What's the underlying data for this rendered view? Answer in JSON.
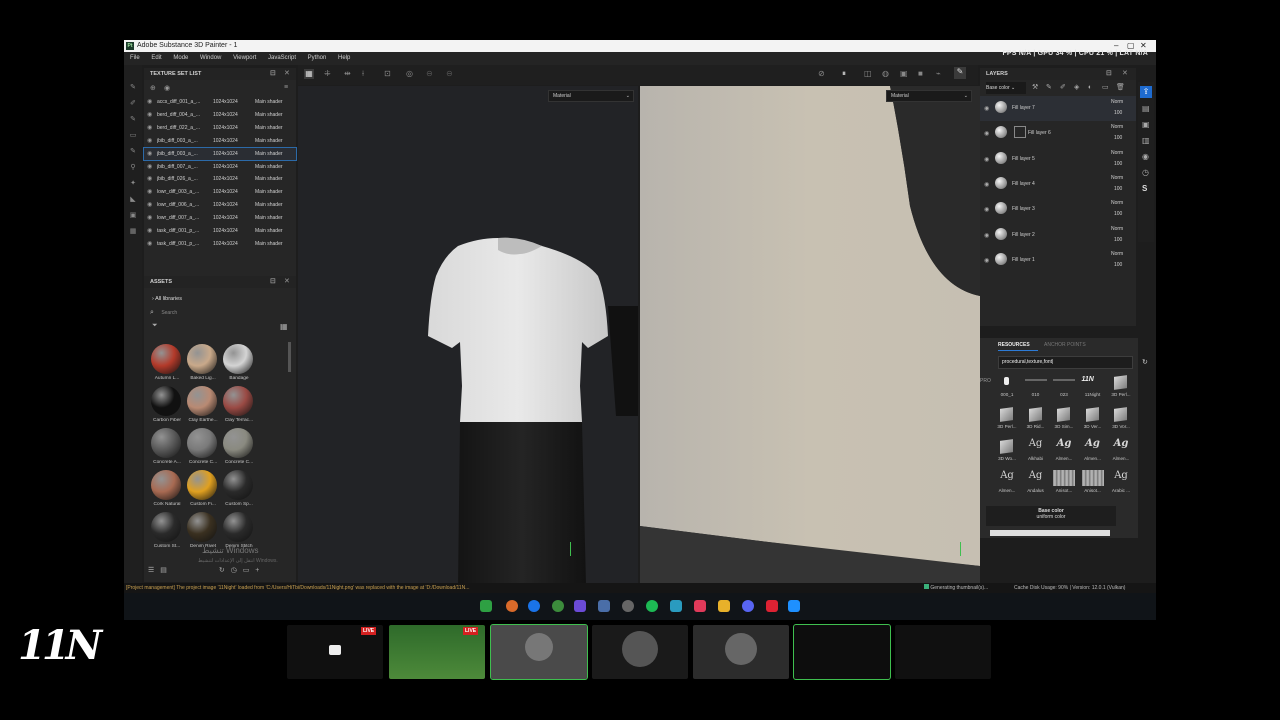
{
  "window": {
    "title": "Adobe Substance 3D Painter - 1",
    "logo_text": "Pt",
    "perf": "FPS N/A | GPU 34 % | CPU 21 % | LAT N/A",
    "controls": [
      "–",
      "▢",
      "✕"
    ]
  },
  "menu": [
    "File",
    "Edit",
    "Mode",
    "Window",
    "Viewport",
    "JavaScript",
    "Python",
    "Help"
  ],
  "texture_set_list": {
    "title": "TEXTURE SET LIST",
    "rows": [
      {
        "name": "accs_diff_001_a_...",
        "res": "1024x1024",
        "shader": "Main shader"
      },
      {
        "name": "berd_diff_004_a_...",
        "res": "1024x1024",
        "shader": "Main shader"
      },
      {
        "name": "berd_diff_022_a_...",
        "res": "1024x1024",
        "shader": "Main shader"
      },
      {
        "name": "jbib_diff_003_a_...",
        "res": "1024x1024",
        "shader": "Main shader"
      },
      {
        "name": "jbib_diff_003_a_...",
        "res": "1024x1024",
        "shader": "Main shader"
      },
      {
        "name": "jbib_diff_007_a_...",
        "res": "1024x1024",
        "shader": "Main shader"
      },
      {
        "name": "jbib_diff_026_a_...",
        "res": "1024x1024",
        "shader": "Main shader"
      },
      {
        "name": "lowr_diff_003_a_...",
        "res": "1024x1024",
        "shader": "Main shader"
      },
      {
        "name": "lowr_diff_006_a_...",
        "res": "1024x1024",
        "shader": "Main shader"
      },
      {
        "name": "lowr_diff_007_a_...",
        "res": "1024x1024",
        "shader": "Main shader"
      },
      {
        "name": "task_diff_001_p_...",
        "res": "1024x1024",
        "shader": "Main shader"
      },
      {
        "name": "task_diff_001_p_...",
        "res": "1024x1024",
        "shader": "Main shader"
      }
    ],
    "selected_index": 4
  },
  "assets": {
    "title": "ASSETS",
    "breadcrumb": "All libraries",
    "search_placeholder": "Search",
    "items": [
      {
        "label": "Autumn L...",
        "color": "#b33a2a"
      },
      {
        "label": "Baked Lig...",
        "color": "#c9a98a"
      },
      {
        "label": "Bandage",
        "color": "#d4d4d4"
      },
      {
        "label": "Carbon Fiber",
        "color": "#111111"
      },
      {
        "label": "Clay Earthe...",
        "color": "#b98a73"
      },
      {
        "label": "Clay Terrac...",
        "color": "#9a4a44"
      },
      {
        "label": "Concrete A...",
        "color": "#5a5a5a"
      },
      {
        "label": "Concrete C...",
        "color": "#7a7a7a"
      },
      {
        "label": "Concrete C...",
        "color": "#8a8a80"
      },
      {
        "label": "Cork Natural",
        "color": "#a86a52"
      },
      {
        "label": "Custom Fi...",
        "color": "#e0a020"
      },
      {
        "label": "Custom Sp...",
        "color": "#2a2a2a"
      },
      {
        "label": "Custom St...",
        "color": "#2a2a2a"
      },
      {
        "label": "Denim Rivet",
        "color": "#3a3020"
      },
      {
        "label": "Denim Stitch",
        "color": "#2a2a2a"
      }
    ],
    "watermark_line1": "تنشيط Windows",
    "watermark_line2": "انتقل إلى الإعدادات لتنشيط Windows."
  },
  "viewport": {
    "left_dropdown": "Material",
    "right_dropdown": "Material"
  },
  "layers": {
    "title": "LAYERS",
    "channel": "Base color",
    "rows": [
      {
        "name": "Fill layer 7",
        "blend": "Norm",
        "opacity": "100"
      },
      {
        "name": "Fill layer 6",
        "blend": "Norm",
        "opacity": "100"
      },
      {
        "name": "Fill layer 5",
        "blend": "Norm",
        "opacity": "100"
      },
      {
        "name": "Fill layer 4",
        "blend": "Norm",
        "opacity": "100"
      },
      {
        "name": "Fill layer 3",
        "blend": "Norm",
        "opacity": "100"
      },
      {
        "name": "Fill layer 2",
        "blend": "Norm",
        "opacity": "100"
      },
      {
        "name": "Fill layer 1",
        "blend": "Norm",
        "opacity": "100"
      }
    ]
  },
  "resources": {
    "tab_active": "RESOURCES",
    "tab_inactive": "ANCHOR POINTS",
    "search_value": "procedural,texture,font|",
    "items": [
      {
        "label": "000_1",
        "kind": "dot"
      },
      {
        "label": "010",
        "kind": "text"
      },
      {
        "label": "023",
        "kind": "text"
      },
      {
        "label": "11Night",
        "kind": "script"
      },
      {
        "label": "3D Perl...",
        "kind": "cube"
      },
      {
        "label": "3D Perl...",
        "kind": "cube"
      },
      {
        "label": "3D Rid...",
        "kind": "cube"
      },
      {
        "label": "3D Sim...",
        "kind": "cube"
      },
      {
        "label": "3D Ver...",
        "kind": "cube"
      },
      {
        "label": "3D Vor...",
        "kind": "cube"
      },
      {
        "label": "3D Wo...",
        "kind": "cube"
      },
      {
        "label": "Alkhabi",
        "kind": "ag"
      },
      {
        "label": "Almen...",
        "kind": "agb"
      },
      {
        "label": "Almen...",
        "kind": "agb"
      },
      {
        "label": "Almen...",
        "kind": "agb"
      },
      {
        "label": "Almen...",
        "kind": "ag"
      },
      {
        "label": "Andalus",
        "kind": "ag"
      },
      {
        "label": "Anisot...",
        "kind": "metal"
      },
      {
        "label": "Anisot...",
        "kind": "metal"
      },
      {
        "label": "Arabic ...",
        "kind": "ag"
      }
    ],
    "glyph": "Ag",
    "tooltip_title": "Base color",
    "tooltip_sub": "uniform color"
  },
  "status": {
    "message": "[Project management] The project image '11Night' loaded from 'C:/Users/HiTbi/Downloads/11Night.png' was replaced with the image at 'D:/Download/11N...",
    "thumbs": "Generating thumbnail(s)...",
    "disk": "Cache Disk Usage: 90% | Version: 12.0.1 (Vulkan)"
  },
  "stream": {
    "live_badge": "LIVE",
    "logo": "11N"
  }
}
